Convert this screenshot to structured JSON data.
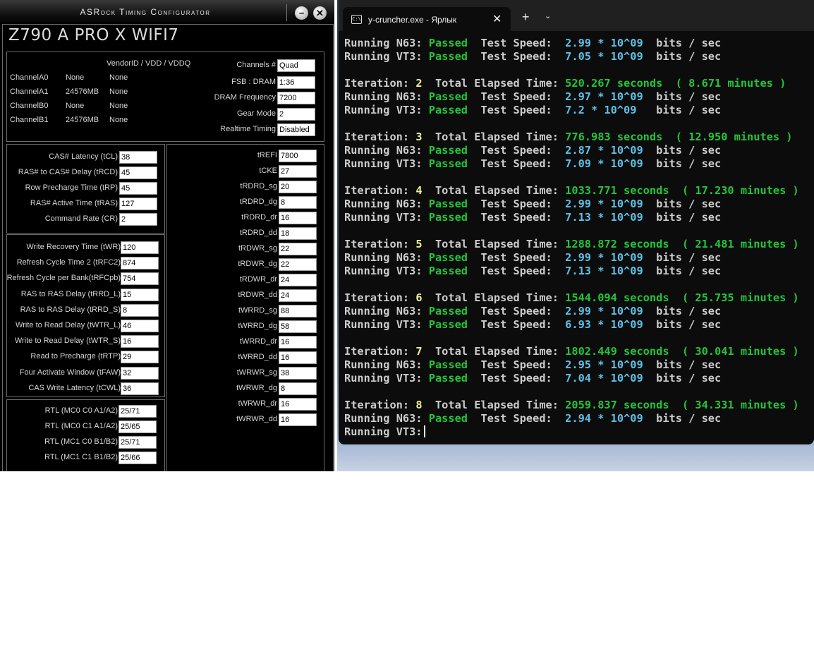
{
  "asrock": {
    "title": "ASRock Timing Configurator",
    "board": "Z790 A PRO X WIFI7",
    "minimize": "−",
    "close": "✕",
    "vendor_header": "VendorID / VDD / VDDQ",
    "channels": [
      {
        "name": "ChannelA0",
        "size": "None",
        "vendor": "None"
      },
      {
        "name": "ChannelA1",
        "size": "24576MB",
        "vendor": "None"
      },
      {
        "name": "ChannelB0",
        "size": "None",
        "vendor": "None"
      },
      {
        "name": "ChannelB1",
        "size": "24576MB",
        "vendor": "None"
      }
    ],
    "info": [
      {
        "label": "Channels #",
        "value": "Quad"
      },
      {
        "label": "FSB : DRAM",
        "value": "1:36"
      },
      {
        "label": "DRAM Frequency",
        "value": "7200"
      },
      {
        "label": "Gear Mode",
        "value": "2"
      },
      {
        "label": "Realtime Timing",
        "value": "Disabled"
      }
    ],
    "primary": [
      {
        "label": "CAS# Latency (tCL)",
        "value": "38"
      },
      {
        "label": "RAS# to CAS# Delay (tRCD)",
        "value": "45"
      },
      {
        "label": "Row Precharge Time (tRP)",
        "value": "45"
      },
      {
        "label": "RAS# Active Time (tRAS)",
        "value": "127"
      },
      {
        "label": "Command Rate (CR)",
        "value": "2"
      }
    ],
    "secondary": [
      {
        "label": "Write Recovery Time (tWR)",
        "value": "120"
      },
      {
        "label": "Refresh Cycle Time 2 (tRFC2)",
        "value": "874"
      },
      {
        "label": "Refresh Cycle per Bank(tRFCpb)",
        "value": "754"
      },
      {
        "label": "RAS to RAS Delay (tRRD_L)",
        "value": "15"
      },
      {
        "label": "RAS to RAS Delay (tRRD_S)",
        "value": "8"
      },
      {
        "label": "Write to Read Delay (tWTR_L)",
        "value": "46"
      },
      {
        "label": "Write to Read Delay (tWTR_S)",
        "value": "16"
      },
      {
        "label": "Read to Precharge (tRTP)",
        "value": "29"
      },
      {
        "label": "Four Activate Window (tFAW)",
        "value": "32"
      },
      {
        "label": "CAS Write Latency (tCWL)",
        "value": "36"
      }
    ],
    "rtl": [
      {
        "label": "RTL (MC0 C0 A1/A2)",
        "value": "25/71"
      },
      {
        "label": "RTL (MC0 C1 A1/A2)",
        "value": "25/65"
      },
      {
        "label": "RTL (MC1 C0 B1/B2)",
        "value": "25/71"
      },
      {
        "label": "RTL (MC1 C1 B1/B2)",
        "value": "25/66"
      }
    ],
    "tertiary": [
      {
        "label": "tREFI",
        "value": "7800"
      },
      {
        "label": "tCKE",
        "value": "27"
      },
      {
        "label": "tRDRD_sg",
        "value": "20"
      },
      {
        "label": "tRDRD_dg",
        "value": "8"
      },
      {
        "label": "tRDRD_dr",
        "value": "16"
      },
      {
        "label": "tRDRD_dd",
        "value": "18"
      },
      {
        "label": "tRDWR_sg",
        "value": "22"
      },
      {
        "label": "tRDWR_dg",
        "value": "22"
      },
      {
        "label": "tRDWR_dr",
        "value": "24"
      },
      {
        "label": "tRDWR_dd",
        "value": "24"
      },
      {
        "label": "tWRRD_sg",
        "value": "88"
      },
      {
        "label": "tWRRD_dg",
        "value": "58"
      },
      {
        "label": "tWRRD_dr",
        "value": "16"
      },
      {
        "label": "tWRRD_dd",
        "value": "16"
      },
      {
        "label": "tWRWR_sg",
        "value": "38"
      },
      {
        "label": "tWRWR_dg",
        "value": "8"
      },
      {
        "label": "tWRWR_dr",
        "value": "16"
      },
      {
        "label": "tWRWR_dd",
        "value": "16"
      }
    ]
  },
  "terminal": {
    "tab_title": "y-cruncher.exe - Ярлык",
    "tab_icon": "C:\\",
    "tab_close": "✕",
    "new_tab": "+",
    "dropdown": "⌄",
    "colors": {
      "passed": "#23c53a",
      "speed": "#5fc0e6",
      "iteration": "#f0ef97",
      "text": "#cccccc",
      "background": "#0c0c0c"
    },
    "words": {
      "running": "Running",
      "passed": "Passed",
      "test_speed": "Test Speed:",
      "unit": "bits / sec",
      "iteration": "Iteration:",
      "total_elapsed": "Total Elapsed Time:"
    },
    "top_lines": [
      {
        "test": "N63:",
        "speed": "2.99 * 10^09"
      },
      {
        "test": "VT3:",
        "speed": "7.05 * 10^09"
      }
    ],
    "iterations": [
      {
        "num": "2",
        "elapsed": "520.267 seconds  ( 8.671 minutes )",
        "runs": [
          {
            "test": "N63:",
            "speed": "2.97 * 10^09"
          },
          {
            "test": "VT3:",
            "speed": "7.2 * 10^09 "
          }
        ]
      },
      {
        "num": "3",
        "elapsed": "776.983 seconds  ( 12.950 minutes )",
        "runs": [
          {
            "test": "N63:",
            "speed": "2.87 * 10^09"
          },
          {
            "test": "VT3:",
            "speed": "7.09 * 10^09"
          }
        ]
      },
      {
        "num": "4",
        "elapsed": "1033.771 seconds  ( 17.230 minutes )",
        "runs": [
          {
            "test": "N63:",
            "speed": "2.99 * 10^09"
          },
          {
            "test": "VT3:",
            "speed": "7.13 * 10^09"
          }
        ]
      },
      {
        "num": "5",
        "elapsed": "1288.872 seconds  ( 21.481 minutes )",
        "runs": [
          {
            "test": "N63:",
            "speed": "2.99 * 10^09"
          },
          {
            "test": "VT3:",
            "speed": "7.13 * 10^09"
          }
        ]
      },
      {
        "num": "6",
        "elapsed": "1544.094 seconds  ( 25.735 minutes )",
        "runs": [
          {
            "test": "N63:",
            "speed": "2.99 * 10^09"
          },
          {
            "test": "VT3:",
            "speed": "6.93 * 10^09"
          }
        ]
      },
      {
        "num": "7",
        "elapsed": "1802.449 seconds  ( 30.041 minutes )",
        "runs": [
          {
            "test": "N63:",
            "speed": "2.95 * 10^09"
          },
          {
            "test": "VT3:",
            "speed": "7.04 * 10^09"
          }
        ]
      },
      {
        "num": "8",
        "elapsed": "2059.837 seconds  ( 34.331 minutes )",
        "runs": [
          {
            "test": "N63:",
            "speed": "2.94 * 10^09"
          }
        ]
      }
    ],
    "last_line": "Running VT3:"
  }
}
